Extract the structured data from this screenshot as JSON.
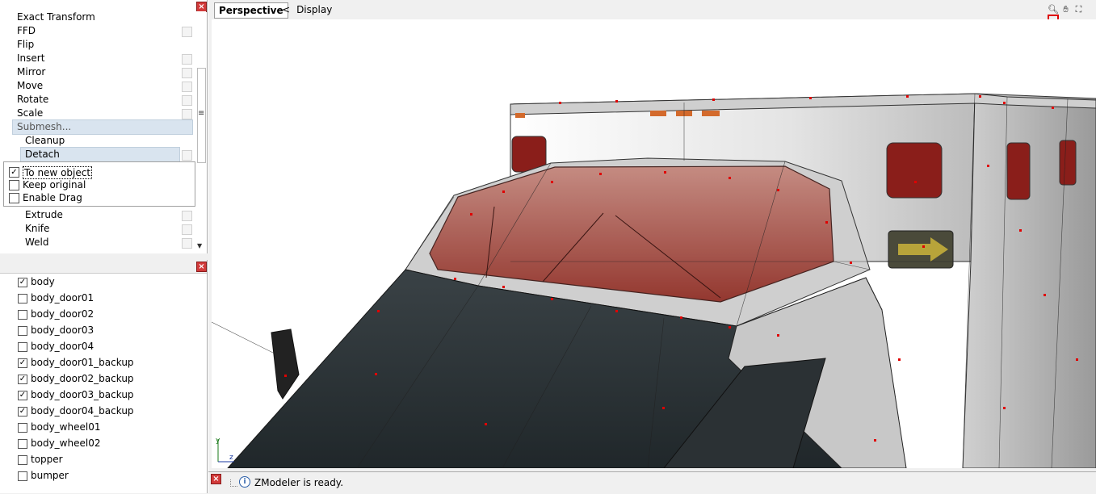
{
  "tools": {
    "items": [
      {
        "label": "Exact Transform",
        "has_option": false
      },
      {
        "label": "FFD",
        "has_option": true
      },
      {
        "label": "Flip",
        "has_option": false
      },
      {
        "label": "Insert",
        "has_option": true
      },
      {
        "label": "Mirror",
        "has_option": true
      },
      {
        "label": "Move",
        "has_option": true
      },
      {
        "label": "Rotate",
        "has_option": true
      },
      {
        "label": "Scale",
        "has_option": true
      }
    ],
    "submesh_label": "Submesh...",
    "sub_items_top": [
      {
        "label": "Cleanup",
        "has_option": false
      },
      {
        "label": "Detach",
        "has_option": true
      }
    ],
    "detach_options": [
      {
        "label": "To new object",
        "checked": true
      },
      {
        "label": "Keep original",
        "checked": false
      },
      {
        "label": "Enable Drag",
        "checked": false
      }
    ],
    "sub_items_bottom": [
      {
        "label": "Extrude",
        "has_option": true
      },
      {
        "label": "Knife",
        "has_option": true
      },
      {
        "label": "Weld",
        "has_option": true
      }
    ]
  },
  "objects": {
    "items": [
      {
        "name": "body",
        "checked": true
      },
      {
        "name": "body_door01",
        "checked": false
      },
      {
        "name": "body_door02",
        "checked": false
      },
      {
        "name": "body_door03",
        "checked": false
      },
      {
        "name": "body_door04",
        "checked": false
      },
      {
        "name": "body_door01_backup",
        "checked": true
      },
      {
        "name": "body_door02_backup",
        "checked": true
      },
      {
        "name": "body_door03_backup",
        "checked": true
      },
      {
        "name": "body_door04_backup",
        "checked": true
      },
      {
        "name": "body_wheel01",
        "checked": false
      },
      {
        "name": "body_wheel02",
        "checked": false
      },
      {
        "name": "topper",
        "checked": false
      },
      {
        "name": "bumper",
        "checked": false
      }
    ]
  },
  "viewport": {
    "tab_label": "Perspective",
    "display_label": "Display",
    "display_chevron": "<",
    "axis_y": "y",
    "axis_z": "z"
  },
  "status": {
    "message": "ZModeler is ready.",
    "info_glyph": "i"
  },
  "colors": {
    "highlight": "#d9e4ef",
    "close_red": "#d23a3a",
    "vertex_red": "#e00000",
    "lightbar_red": "#a83a32",
    "body_dark": "#2e3538"
  }
}
